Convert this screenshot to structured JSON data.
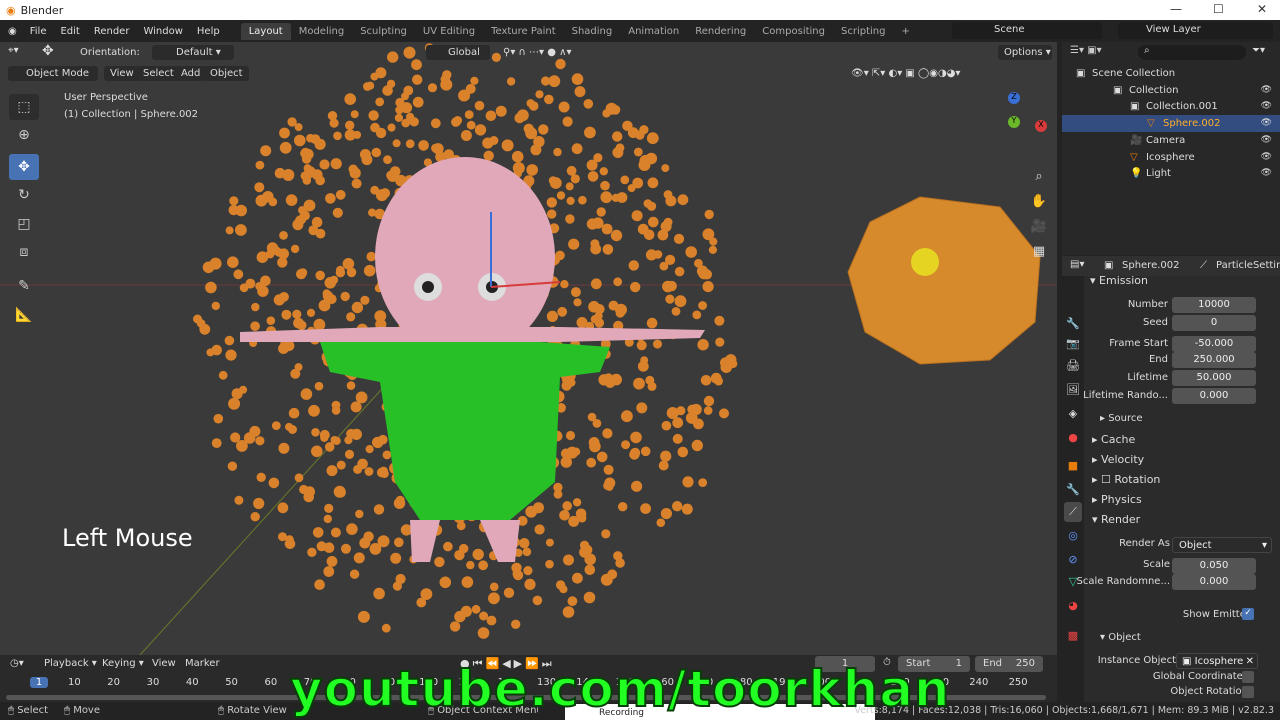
{
  "window": {
    "title": "Blender",
    "minimize": "—",
    "maximize": "☐",
    "close": "✕"
  },
  "menu": [
    "File",
    "Edit",
    "Render",
    "Window",
    "Help"
  ],
  "workspaces": [
    "Layout",
    "Modeling",
    "Sculpting",
    "UV Editing",
    "Texture Paint",
    "Shading",
    "Animation",
    "Rendering",
    "Compositing",
    "Scripting",
    "+"
  ],
  "scene": {
    "scene_name": "Scene",
    "view_layer": "View Layer"
  },
  "tool_header": {
    "orientation_label": "Orientation:",
    "orientation_value": "Default",
    "transform": "Global",
    "options": "Options"
  },
  "viewport_header": {
    "mode": "Object Mode",
    "menus": [
      "View",
      "Select",
      "Add",
      "Object"
    ]
  },
  "viewport": {
    "perspective": "User Perspective",
    "context": "(1) Collection | Sphere.002",
    "overlay_text": "Left Mouse",
    "axis_labels": {
      "x": "X",
      "y": "Y",
      "z": "Z"
    }
  },
  "outliner": {
    "items": [
      {
        "label": "Scene Collection",
        "depth": 0,
        "icon": "collection-icon"
      },
      {
        "label": "Collection",
        "depth": 1,
        "icon": "collection-icon"
      },
      {
        "label": "Collection.001",
        "depth": 2,
        "icon": "collection-icon"
      },
      {
        "label": "Sphere.002",
        "depth": 3,
        "icon": "mesh-icon",
        "selected": true
      },
      {
        "label": "Camera",
        "depth": 2,
        "icon": "camera-icon"
      },
      {
        "label": "Icosphere",
        "depth": 2,
        "icon": "mesh-icon"
      },
      {
        "label": "Light",
        "depth": 2,
        "icon": "light-icon"
      }
    ]
  },
  "properties": {
    "object": "Sphere.002",
    "particle_settings": "ParticleSettings",
    "emission_label": "Emission",
    "fields": [
      {
        "label": "Number",
        "value": "10000"
      },
      {
        "label": "Seed",
        "value": "0"
      },
      {
        "label": "Frame Start",
        "value": "-50.000"
      },
      {
        "label": "End",
        "value": "250.000"
      },
      {
        "label": "Lifetime",
        "value": "50.000"
      },
      {
        "label": "Lifetime Rando...",
        "value": "0.000"
      }
    ],
    "sections": [
      "Source",
      "Cache",
      "Velocity",
      "Rotation",
      "Physics",
      "Render"
    ],
    "render_as_label": "Render As",
    "render_as": "Object",
    "scale_label": "Scale",
    "scale": "0.050",
    "scale_random_label": "Scale Randomne...",
    "scale_random": "0.000",
    "show_emitter": "Show Emitter",
    "object_section": "Object",
    "instance_object_label": "Instance Object",
    "instance_object": "Icosphere",
    "global_coordinates": "Global Coordinates",
    "object_rotation": "Object Rotation"
  },
  "timeline": {
    "menus": [
      "Playback",
      "Keying",
      "View",
      "Marker"
    ],
    "current_frame": "1",
    "start_label": "Start",
    "start": "1",
    "end_label": "End",
    "end": "250",
    "ticks": [
      "1",
      "10",
      "20",
      "30",
      "40",
      "50",
      "60",
      "70",
      "80",
      "90",
      "100",
      "110",
      "120",
      "130",
      "140",
      "150",
      "160",
      "170",
      "180",
      "190",
      "200",
      "210",
      "220",
      "230",
      "240",
      "250"
    ]
  },
  "status": {
    "select": "Select",
    "move": "Move",
    "rotate": "Rotate View",
    "context": "Object Context Menu",
    "recording": "Recording",
    "stats": "Verts:8,174 | Faces:12,038 | Tris:16,060 | Objects:1,668/1,671 | Mem: 89.3 MiB | v2.82.3"
  },
  "watermark": "youtube.com/toorkhan",
  "colors": {
    "accent": "#4772b3",
    "particle": "#d9822b",
    "shirt": "#27c027",
    "skin": "#e0a8b8",
    "watermark": "#22ff22"
  }
}
